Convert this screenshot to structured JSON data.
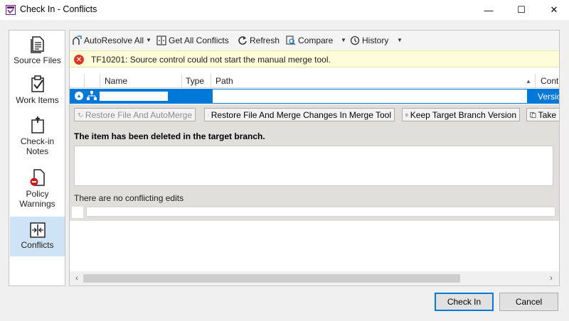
{
  "window": {
    "title": "Check In - Conflicts",
    "minimize": "—",
    "maximize": "☐",
    "close": "✕"
  },
  "nav": {
    "items": [
      {
        "label": "Source Files",
        "icon": "source-files-icon"
      },
      {
        "label": "Work Items",
        "icon": "work-items-icon"
      },
      {
        "label": "Check-in Notes",
        "icon": "checkin-notes-icon"
      },
      {
        "label": "Policy Warnings",
        "icon": "policy-warnings-icon"
      },
      {
        "label": "Conflicts",
        "icon": "conflicts-icon",
        "selected": true
      }
    ]
  },
  "toolbar": {
    "autoresolve": "AutoResolve All",
    "get_all": "Get All Conflicts",
    "refresh": "Refresh",
    "compare": "Compare",
    "history": "History"
  },
  "error": {
    "message": "TF10201: Source control could not start the manual merge tool."
  },
  "grid": {
    "columns": [
      "Name",
      "Type",
      "Path",
      "Cont"
    ],
    "row": {
      "conflict": "Versio"
    }
  },
  "actions": {
    "restore_automerge": "Restore File And AutoMerge",
    "restore_merge_tool": "Restore File And Merge Changes In Merge Tool",
    "keep_target": "Keep Target Branch Version",
    "take": "Take"
  },
  "detail": {
    "deleted_message": "The item has been deleted in the target branch.",
    "no_edits": "There are no conflicting edits"
  },
  "footer": {
    "check_in": "Check In",
    "cancel": "Cancel"
  },
  "colors": {
    "selection": "#0078d7",
    "error_bg": "#fffcd9",
    "error_icon": "#d73b2a",
    "nav_selected": "#cfe3f6"
  }
}
